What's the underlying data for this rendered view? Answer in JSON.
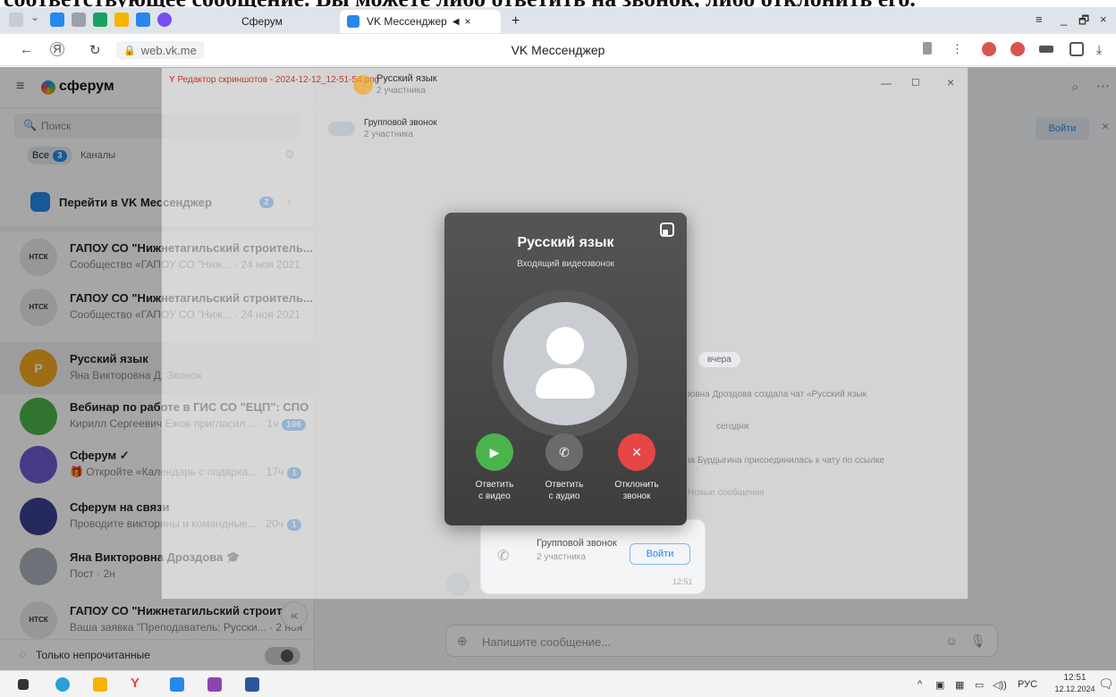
{
  "doc_text": "соответствующее сообщение. Вы можете либо ответить на звонок, либо отклонить его.",
  "browser": {
    "tabs": [
      {
        "label": "Сферум"
      },
      {
        "label": "VK Мессенджер",
        "audio_icon": "speaker-icon",
        "close": "×"
      }
    ],
    "new_tab": "+",
    "window_controls": [
      "≡",
      "_",
      "🗗",
      "×"
    ],
    "url": "web.vk.me",
    "page_title": "VK Мессенджер"
  },
  "sidebar": {
    "brand": "сферум",
    "search_placeholder": "Поиск",
    "filters": {
      "all": "Все",
      "all_count": "3",
      "channels": "Каналы"
    },
    "promo": {
      "label": "Перейти в VK Мессенджер",
      "count": "2"
    },
    "chats": [
      {
        "name": "ГАПОУ СО \"Нижнетагильский строитель...",
        "sub": "Сообщество «ГАПОУ СО \"Ниж... · 24 ноя 2021",
        "avatar": "НТСК",
        "color": "#e8e8e8"
      },
      {
        "name": "ГАПОУ СО \"Нижнетагильский строитель...",
        "sub": "Сообщество «ГАПОУ СО \"Ниж... · 24 ноя 2021",
        "avatar": "НТСК",
        "color": "#e8e8e8"
      },
      {
        "name": "Русский язык",
        "sub": "Яна Викторовна Д: Звонок",
        "avatar": "Р",
        "color": "#f5a623"
      },
      {
        "name": "Вебинар по работе в ГИС СО \"ЕЦП\": СПО",
        "sub": "Кирилл Сергеевич Ежов пригласил ... · 1ч",
        "badge": "106",
        "avatar": "",
        "color": "#4bb34b"
      },
      {
        "name": "Сферум ✓",
        "sub": "🎁 Откройте «Календарь с подарка... · 17ч",
        "badge": "1",
        "avatar": "",
        "color": "#6a5acd"
      },
      {
        "name": "Сферум на связи",
        "sub": "Проводите викторины и командные... · 20ч",
        "badge": "1",
        "avatar": "",
        "color": "#3a3f8f"
      },
      {
        "name": "Яна Викторовна Дроздова 🎓",
        "sub": "Пост · 2н",
        "avatar": "",
        "color": "#aab0b8"
      },
      {
        "name": "ГАПОУ СО \"Нижнетагильский строител...",
        "sub": "Ваша заявка \"Преподаватель: Русски... · 2 ноя",
        "avatar": "НТСК",
        "color": "#e8e8e8"
      }
    ],
    "unread_only": "Только непрочитанные",
    "collapse": "«"
  },
  "screenshot_overlay": {
    "title": "Редактор скриншотов - 2024-12-12_12-51-54.png",
    "chat_name": "Русский язык",
    "chat_members": "2 участника",
    "group_call_label": "Групповой звонок",
    "group_call_members": "2 участника",
    "date_yesterday": "вчера",
    "created_msg": "Яна Викторовна Дроздова создала чат «Русский язык»",
    "date_today": "сегодня",
    "joined_msg": "Наталья Николаевна Бурдыгина присоединилась к чату по ссылке",
    "new_messages": "Новые сообщения",
    "card_title": "Групповой звонок",
    "card_members": "2 участника",
    "card_join": "Войти",
    "card_time": "12:51"
  },
  "topbar_right": {
    "join": "Войти"
  },
  "call": {
    "title": "Русский язык",
    "subtitle": "Входящий видеозвонок",
    "actions": [
      {
        "label_1": "Ответить",
        "label_2": "с видео",
        "color": "#4bb34b"
      },
      {
        "label_1": "Ответить",
        "label_2": "с аудио",
        "color": "#6b6b6b"
      },
      {
        "label_1": "Отклонить",
        "label_2": "звонок",
        "color": "#e64646"
      }
    ]
  },
  "composer": {
    "placeholder": "Напишите сообщение..."
  },
  "taskbar": {
    "tray_lang": "РУС",
    "time": "12:51",
    "date": "12.12.2024"
  }
}
